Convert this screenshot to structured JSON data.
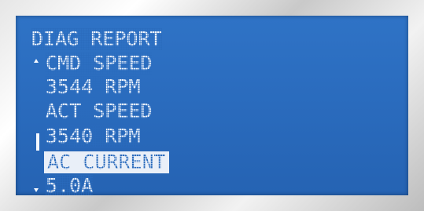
{
  "display": {
    "title": "DIAG REPORT",
    "rows": [
      {
        "label": "CMD SPEED"
      },
      {
        "label": "3544 RPM"
      },
      {
        "label": "ACT SPEED"
      },
      {
        "label": "3540 RPM"
      },
      {
        "label": "AC CURRENT",
        "selected": true
      },
      {
        "label": "5.0A"
      }
    ]
  },
  "colors": {
    "screen_background": "#2a6bbd",
    "text": "#f4f8ff",
    "highlight_background": "#e9eff8"
  },
  "icons": {
    "scroll_up": "triangle-up-icon",
    "scroll_down": "triangle-down-icon"
  }
}
